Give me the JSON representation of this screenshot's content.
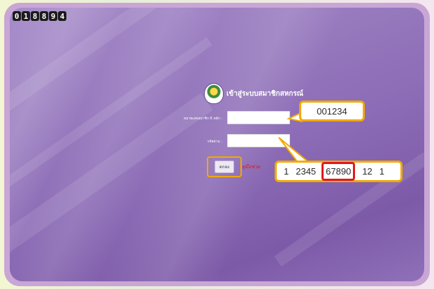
{
  "counter": {
    "digits": [
      "0",
      "1",
      "8",
      "8",
      "9",
      "4"
    ]
  },
  "login": {
    "title": "เข้าสู่ระบบสมาชิกสหกรณ์",
    "member_label": "หมายเลขสมาชิก 6 หลัก :",
    "password_label": "รหัสผ่าน :",
    "submit_label": "ตกลง",
    "help_link": "คู่มือช่วย"
  },
  "callouts": {
    "member_example": "001234",
    "password_parts": [
      "1",
      "2345",
      "67890",
      "12",
      "1"
    ]
  },
  "colors": {
    "highlight_orange": "#f2a900",
    "highlight_red": "#e01a1a",
    "link_red": "#d91a1a"
  }
}
